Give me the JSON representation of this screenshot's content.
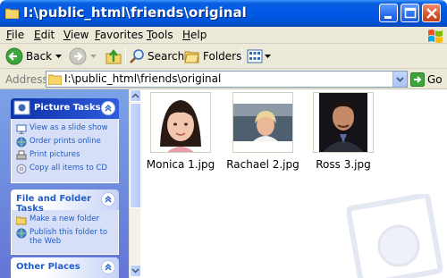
{
  "window": {
    "title": "I:\\public_html\\friends\\original"
  },
  "menu": {
    "items": [
      {
        "first": "F",
        "rest": "ile"
      },
      {
        "first": "E",
        "rest": "dit"
      },
      {
        "first": "V",
        "rest": "iew"
      },
      {
        "first": "F",
        "rest": "avorites"
      },
      {
        "first": "T",
        "rest": "ools"
      },
      {
        "first": "H",
        "rest": "elp"
      }
    ]
  },
  "toolbar": {
    "back_label": "Back",
    "search_label": "Search",
    "folders_label": "Folders"
  },
  "address": {
    "label": "Address",
    "value": "I:\\public_html\\friends\\original",
    "go_label": "Go"
  },
  "sidebar": {
    "picture_tasks": {
      "title": "Picture Tasks",
      "items": [
        "View as a slide show",
        "Order prints online",
        "Print pictures",
        "Copy all items to CD"
      ]
    },
    "file_folder_tasks": {
      "title": "File and Folder Tasks",
      "items": [
        "Make a new folder",
        "Publish this folder to the Web"
      ]
    },
    "other_places": {
      "title": "Other Places"
    }
  },
  "files": [
    {
      "name": "Monica 1.jpg"
    },
    {
      "name": "Rachael 2.jpg"
    },
    {
      "name": "Ross 3.jpg"
    }
  ],
  "colors": {
    "title_blue": "#0058e6",
    "task_link": "#215dc6",
    "sidebar_bg": "#7ba2e7"
  }
}
